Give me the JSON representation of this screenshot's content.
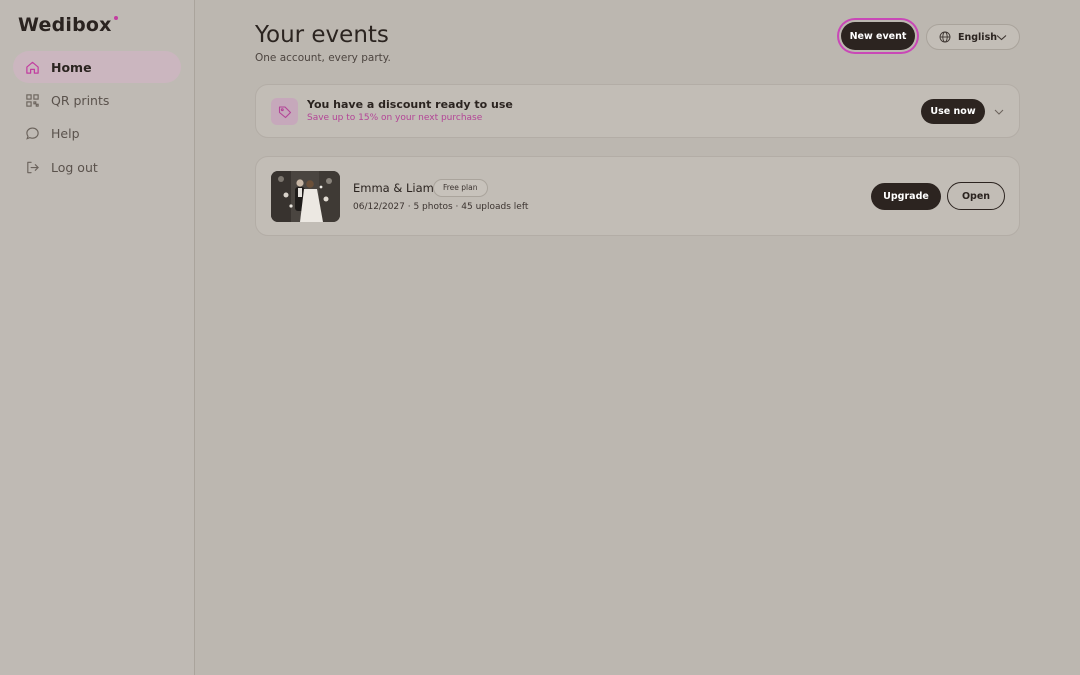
{
  "brand": {
    "name": "Wedibox",
    "accent": "#c23da0"
  },
  "sidebar": {
    "items": [
      {
        "label": "Home",
        "icon": "home-icon",
        "active": true
      },
      {
        "label": "QR prints",
        "icon": "qr-code-icon",
        "active": false
      },
      {
        "label": "Help",
        "icon": "chat-bubble-icon",
        "active": false
      },
      {
        "label": "Log out",
        "icon": "logout-icon",
        "active": false
      }
    ]
  },
  "header": {
    "title": "Your events",
    "subtitle": "One account, every party.",
    "new_event_label": "New event",
    "language": "English"
  },
  "discount": {
    "title": "You have a discount ready to use",
    "subtitle": "Save up to 15% on your next purchase",
    "action_label": "Use now"
  },
  "events": [
    {
      "name": "Emma & Liam",
      "plan_badge": "Free plan",
      "meta": "06/12/2027 · 5 photos · 45 uploads left",
      "upgrade_label": "Upgrade",
      "open_label": "Open"
    }
  ],
  "colors": {
    "background": "#bcb7b0",
    "dark_button": "#2c2420",
    "active_nav": "#cbb6bf",
    "focus_ring": "#c948b7",
    "discount_text": "#b34597"
  }
}
